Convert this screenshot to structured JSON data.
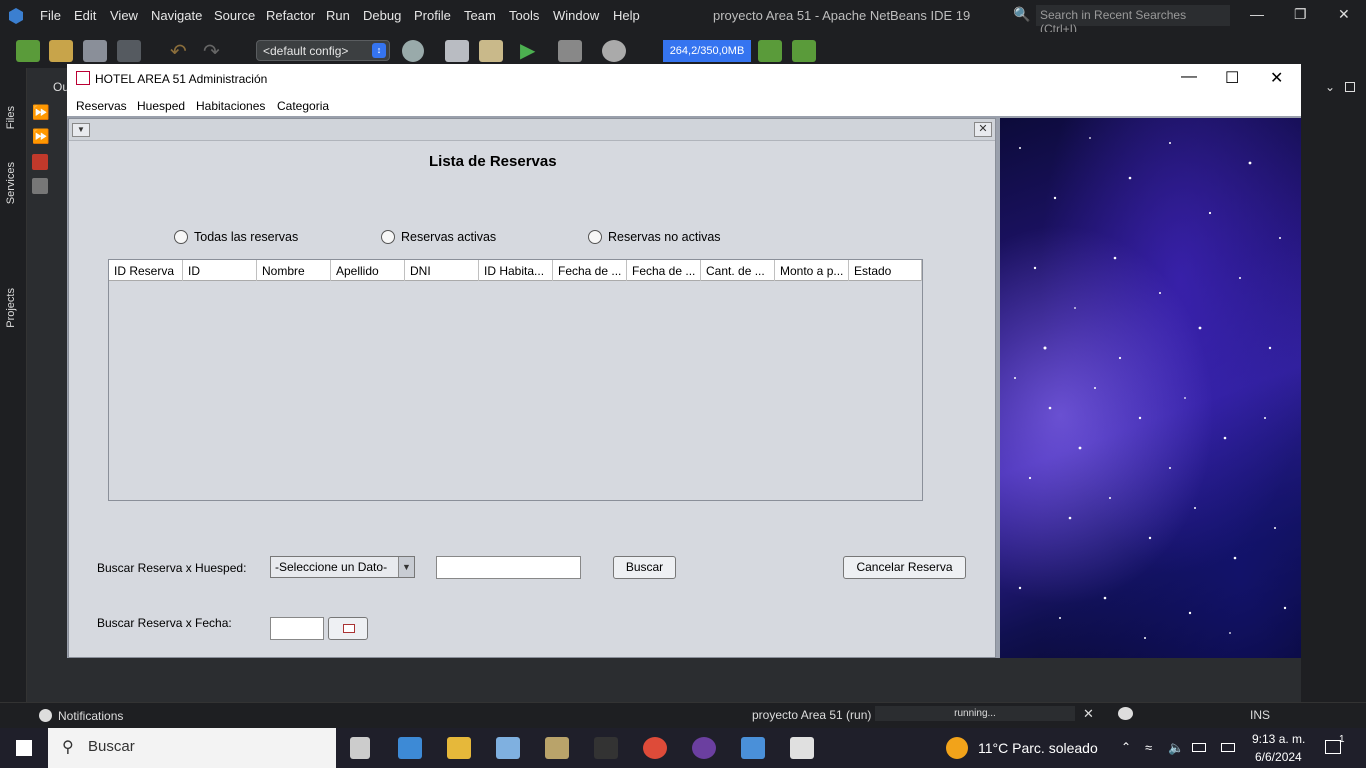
{
  "ide": {
    "menus": [
      "File",
      "Edit",
      "View",
      "Navigate",
      "Source",
      "Refactor",
      "Run",
      "Debug",
      "Profile",
      "Team",
      "Tools",
      "Window",
      "Help"
    ],
    "title": "proyecto Area 51 - Apache NetBeans IDE 19",
    "search_placeholder": "Search in Recent Searches (Ctrl+I)",
    "config": "<default config>",
    "memory": "264,2/350,0MB",
    "side_tabs": [
      "Files",
      "Services",
      "Projects"
    ],
    "editor_tab_fragment": "Ou",
    "status": {
      "notifications": "Notifications",
      "run_label": "proyecto Area 51 (run)",
      "progress_text": "running...",
      "mode": "INS"
    }
  },
  "app": {
    "title": "HOTEL AREA 51 Administración",
    "menus": [
      "Reservas",
      "Huesped",
      "Habitaciones",
      "Categoria"
    ],
    "frame": {
      "heading": "Lista de Reservas",
      "radios": [
        "Todas las reservas",
        "Reservas activas",
        "Reservas no activas"
      ],
      "table_columns": [
        "ID Reserva",
        "ID",
        "Nombre",
        "Apellido",
        "DNI",
        "ID Habita...",
        "Fecha de ...",
        "Fecha de ...",
        "Cant. de ...",
        "Monto a p...",
        "Estado"
      ],
      "search_guest_label": "Buscar Reserva x Huesped:",
      "combo_value": "-Seleccione un Dato-",
      "search_button": "Buscar",
      "cancel_button": "Cancelar Reserva",
      "search_date_label": "Buscar Reserva x Fecha:"
    }
  },
  "taskbar": {
    "search": "Buscar",
    "weather": "11°C  Parc. soleado",
    "time": "9:13 a. m.",
    "date": "6/6/2024",
    "notification_count": "1"
  }
}
